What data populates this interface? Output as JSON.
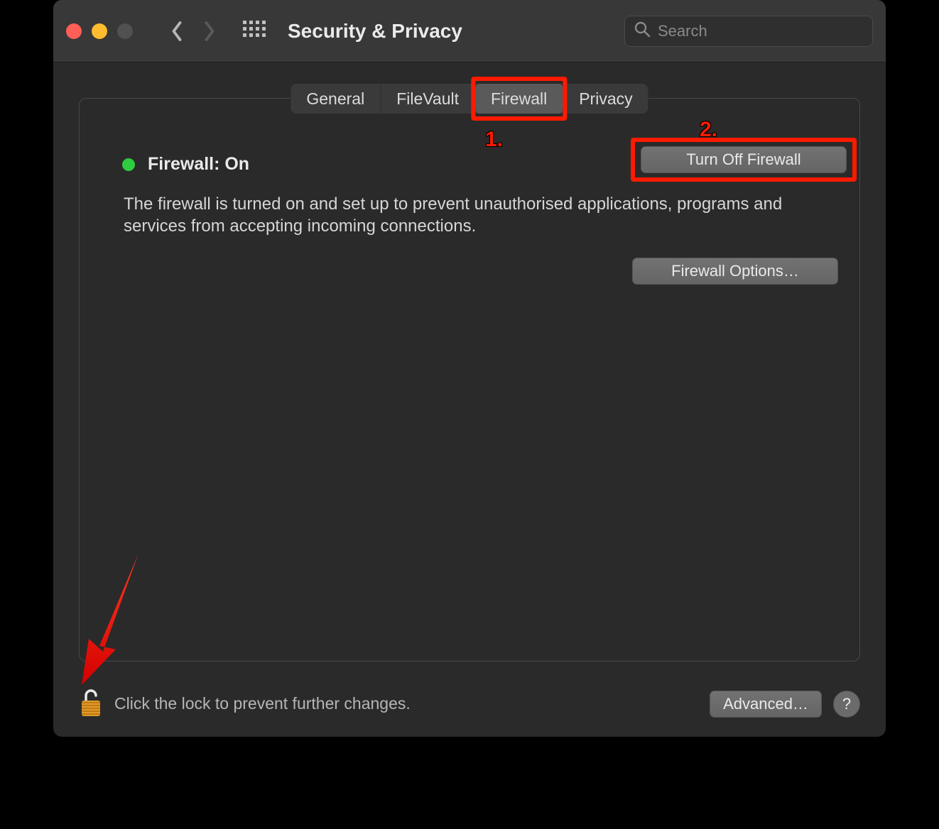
{
  "toolbar": {
    "title": "Security & Privacy",
    "search_placeholder": "Search"
  },
  "tabs": {
    "general": "General",
    "filevault": "FileVault",
    "firewall": "Firewall",
    "privacy": "Privacy"
  },
  "status": {
    "label": "Firewall: On",
    "dot_color": "#2ecc40"
  },
  "buttons": {
    "turn_off": "Turn Off Firewall",
    "options": "Firewall Options…",
    "advanced": "Advanced…"
  },
  "description": "The firewall is turned on and set up to prevent unauthorised applications, programs and services from accepting incoming connections.",
  "footer": {
    "lock_text": "Click the lock to prevent further changes."
  },
  "annotations": {
    "label1": "1.",
    "label2": "2."
  }
}
